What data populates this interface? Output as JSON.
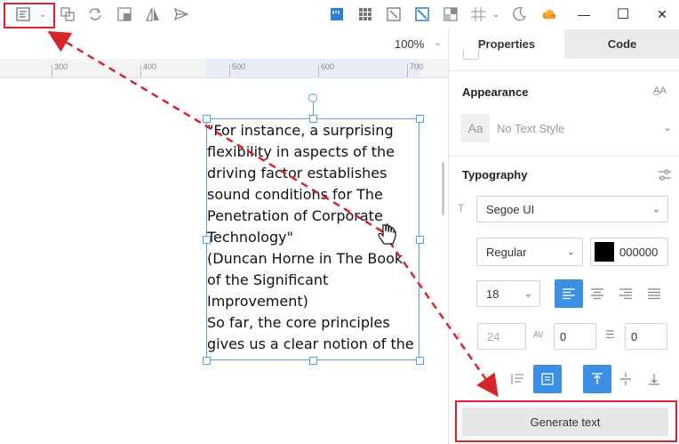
{
  "toolbar": {
    "icons": [
      "text-style-icon",
      "dropdown-icon",
      "group-icon",
      "refresh-icon",
      "crop-icon",
      "flip-icon",
      "send-icon",
      "ruler-icon",
      "grid-icon",
      "scale-icon",
      "line-icon",
      "mask-icon",
      "hash-grid-icon",
      "chevron-down-icon",
      "moon-icon",
      "cloud-icon"
    ],
    "window": {
      "minimize": "—",
      "maximize": "☐",
      "close": "✕"
    }
  },
  "canvas": {
    "zoom": "100%",
    "ruler_ticks": [
      "300",
      "400",
      "500",
      "600",
      "700"
    ],
    "text_content": "\"For instance, a surprising flexibility in aspects of the driving factor establishes sound conditions for The Penetration of Corporate Technology\"\n(Duncan Horne in The Book of the Significant Improvement)\nSo far, the core principles gives us a clear notion of the"
  },
  "panel": {
    "tabs": [
      "Properties",
      "Code"
    ],
    "appearance": {
      "title": "Appearance",
      "text_style": "No Text Style",
      "aa_glyph": "Aa"
    },
    "typography": {
      "title": "Typography",
      "font_family": "Segoe UI",
      "font_weight": "Regular",
      "color_hex": "000000",
      "color_value": "#000000",
      "font_size": "18",
      "line_height": "24",
      "letter_spacing": "0",
      "paragraph_spacing": "0"
    },
    "generate_button": "Generate text"
  },
  "colors": {
    "accent": "#3b8fe3",
    "annotation": "#d9232a"
  }
}
